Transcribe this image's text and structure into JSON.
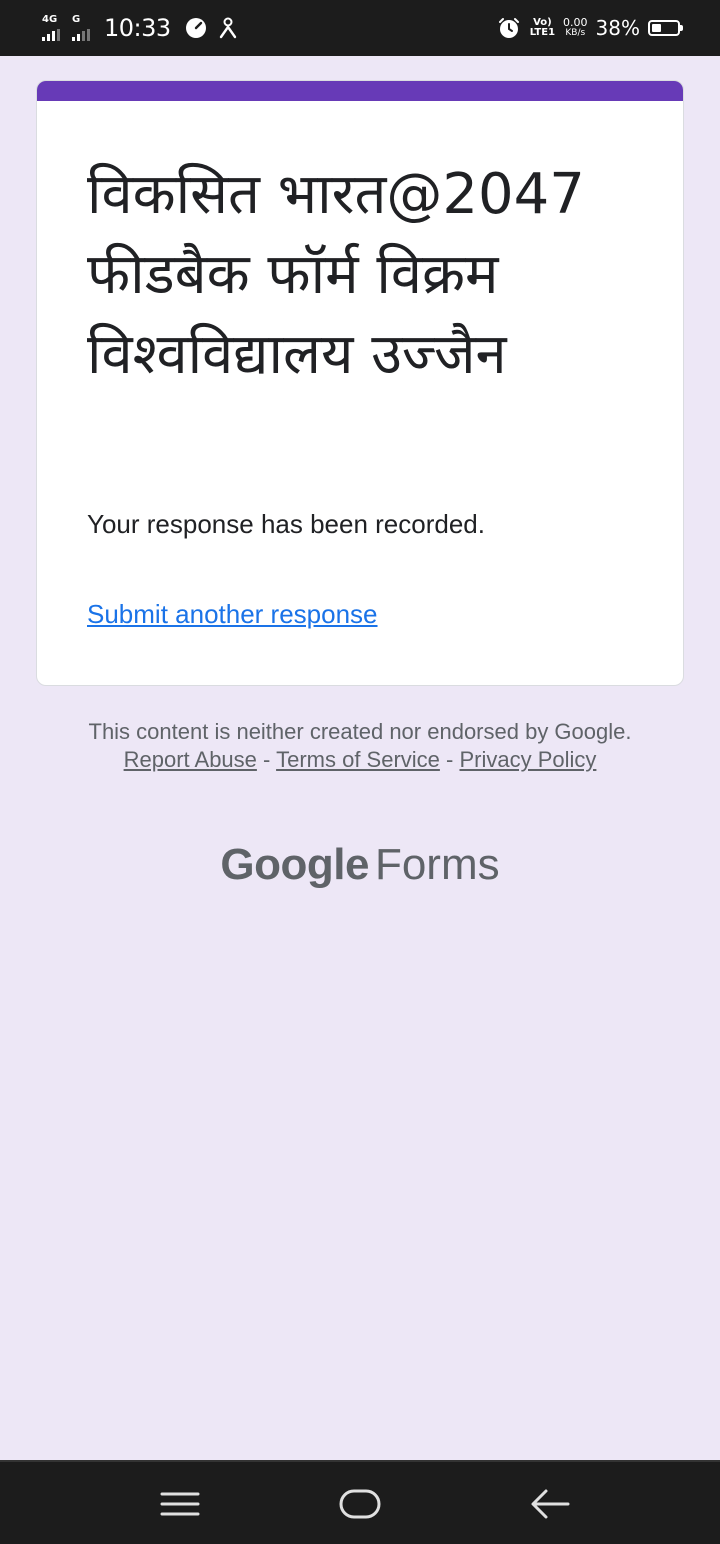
{
  "status_bar": {
    "network1": "4G",
    "network2": "G",
    "time": "10:33",
    "volte_top": "Vo)",
    "volte_bottom": "LTE1",
    "speed_value": "0.00",
    "speed_unit": "KB/s",
    "battery_percent": "38%",
    "battery_level": 0.38
  },
  "form": {
    "accent_color": "#673ab7",
    "title": "विकसित भारत@2047 फीडबैक फॉर्म विक्रम विश्वविद्यालय उज्जैन",
    "confirmation": "Your response has been recorded.",
    "submit_another": "Submit another response"
  },
  "footer": {
    "disclaimer": "This content is neither created nor endorsed by Google.",
    "report_abuse": "Report Abuse",
    "sep": "-",
    "terms": "Terms of Service",
    "privacy": "Privacy Policy",
    "brand_google": "Google",
    "brand_forms": "Forms"
  },
  "nav_bar": {
    "icons": [
      "menu-icon",
      "home-icon",
      "back-icon"
    ]
  }
}
